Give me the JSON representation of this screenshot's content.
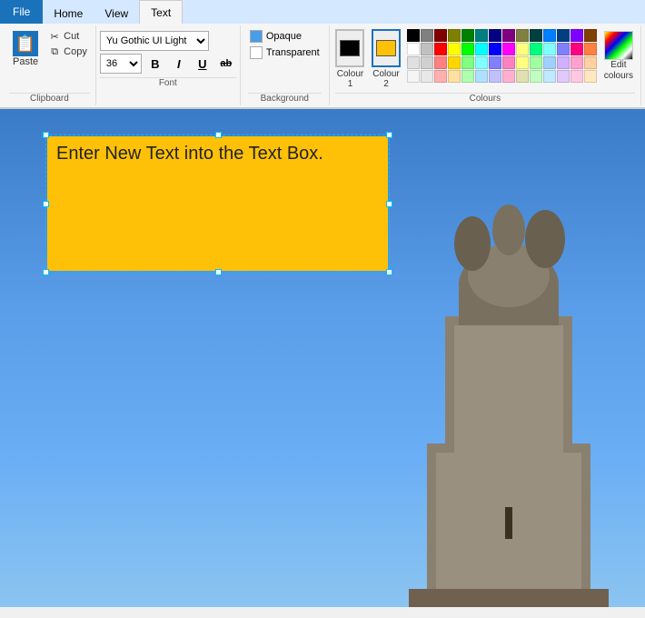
{
  "tabs": [
    {
      "id": "file",
      "label": "File",
      "active_file": true
    },
    {
      "id": "home",
      "label": "Home",
      "active": false
    },
    {
      "id": "view",
      "label": "View",
      "active": false
    },
    {
      "id": "text",
      "label": "Text",
      "active": true
    }
  ],
  "clipboard": {
    "paste_label": "Paste",
    "cut_label": "Cut",
    "copy_label": "Copy",
    "section_label": "Clipboard"
  },
  "font": {
    "current_font": "Yu Gothic UI Light",
    "current_size": "36",
    "bold_label": "B",
    "italic_label": "I",
    "underline_label": "U",
    "strikethrough_label": "ab",
    "section_label": "Font"
  },
  "background": {
    "opaque_label": "Opaque",
    "transparent_label": "Transparent",
    "section_label": "Background"
  },
  "colours": {
    "colour1_label": "Colour 1",
    "colour2_label": "Colour 2",
    "edit_colours_label": "Edit colours",
    "section_label": "Colours",
    "colour1_value": "#000000",
    "colour2_value": "#ffc107",
    "palette": [
      [
        "#000000",
        "#808080",
        "#800000",
        "#808000",
        "#008000",
        "#008080",
        "#000080",
        "#800080",
        "#808040",
        "#004040",
        "#0080ff",
        "#004080",
        "#8000ff",
        "#804000"
      ],
      [
        "#ffffff",
        "#c0c0c0",
        "#ff0000",
        "#ffff00",
        "#00ff00",
        "#00ffff",
        "#0000ff",
        "#ff00ff",
        "#ffff80",
        "#00ff80",
        "#80ffff",
        "#8080ff",
        "#ff0080",
        "#ff8040"
      ],
      [
        "#000000",
        "#404040",
        "#ff8080",
        "#ffd700",
        "#80ff80",
        "#80ffff",
        "#8080ff",
        "#ff80c0",
        "#ffff80",
        "#a0ffa0",
        "#a0d0ff",
        "#d0b0ff",
        "#ffa0d0",
        "#ffd0a0"
      ],
      [
        "#000000",
        "#202020",
        "#ffb0b0",
        "#ffe0a0",
        "#b0ffb0",
        "#b0e0ff",
        "#c0c0ff",
        "#ffb0d0",
        "#e0e0b0",
        "#c0ffc0",
        "#c0e8ff",
        "#e0c8ff",
        "#ffc8e0",
        "#ffe8c0"
      ]
    ]
  },
  "textbox": {
    "text": "Enter New Text into the Text Box.",
    "background_color": "#ffc107",
    "font": "Yu Gothic UI Light"
  }
}
